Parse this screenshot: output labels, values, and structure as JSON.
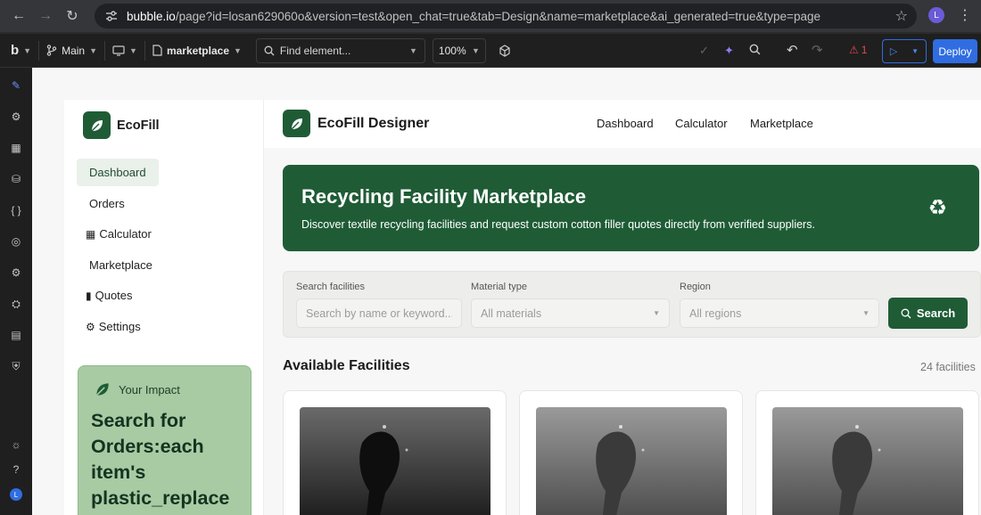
{
  "browser": {
    "url_host": "bubble.io",
    "url_rest": "/page?id=losan629060o&version=test&open_chat=true&tab=Design&name=marketplace&ai_generated=true&type=page",
    "profile_initial": "L"
  },
  "toolbar": {
    "logo": "b",
    "branch": "Main",
    "page_name": "marketplace",
    "find_placeholder": "Find element...",
    "zoom": "100%",
    "issues_count": "1",
    "deploy_label": "Deploy"
  },
  "rail": {
    "avatar_initial": "L"
  },
  "app": {
    "brand": "EcoFill",
    "nav": [
      {
        "label": "Dashboard",
        "icon": ""
      },
      {
        "label": "Orders",
        "icon": ""
      },
      {
        "label": "Calculator",
        "icon": "calculator-icon"
      },
      {
        "label": "Marketplace",
        "icon": ""
      },
      {
        "label": "Quotes",
        "icon": "document-icon"
      },
      {
        "label": "Settings",
        "icon": "gear-icon"
      }
    ],
    "impact": {
      "title": "Your Impact",
      "body": "Search for Orders:each item's plastic_replace"
    }
  },
  "main": {
    "brand": "EcoFill Designer",
    "links": [
      "Dashboard",
      "Calculator",
      "Marketplace"
    ],
    "hero": {
      "title": "Recycling Facility Marketplace",
      "subtitle": "Discover textile recycling facilities and request custom cotton filler quotes directly from verified suppliers.",
      "icon": "recycle-icon"
    },
    "filters": {
      "search_label": "Search facilities",
      "search_placeholder": "Search by name or keyword...",
      "material_label": "Material type",
      "material_value": "All materials",
      "region_label": "Region",
      "region_value": "All regions",
      "button": "Search"
    },
    "section_title": "Available Facilities",
    "section_count": "24 facilities",
    "cards": [
      {
        "image": "facility-photo"
      },
      {
        "image": "facility-photo"
      },
      {
        "image": "facility-photo"
      }
    ]
  },
  "colors": {
    "brand_green": "#1f5c36",
    "impact_green": "#a8cba3",
    "deploy_blue": "#2f6de1"
  }
}
